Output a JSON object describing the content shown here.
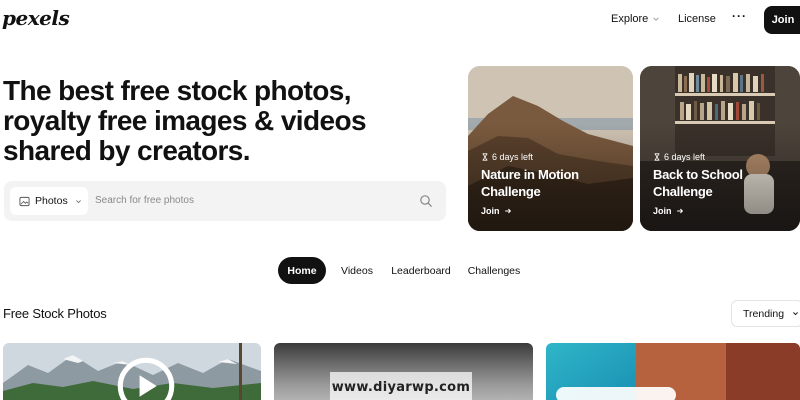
{
  "header": {
    "logo": "pexels",
    "nav": {
      "explore": "Explore",
      "license": "License",
      "more": "···",
      "join": "Join"
    }
  },
  "hero": {
    "title": "The best free stock photos, royalty free images & videos shared by creators.",
    "search": {
      "type_label": "Photos",
      "placeholder": "Search for free photos"
    }
  },
  "challenges": [
    {
      "time_left": "6 days left",
      "title": "Nature in Motion Challenge",
      "cta": "Join"
    },
    {
      "time_left": "6 days left",
      "title": "Back to School Challenge",
      "cta": "Join"
    }
  ],
  "tabs": [
    {
      "label": "Home",
      "active": true
    },
    {
      "label": "Videos"
    },
    {
      "label": "Leaderboard"
    },
    {
      "label": "Challenges"
    }
  ],
  "section": {
    "title": "Free Stock Photos",
    "sort": "Trending"
  },
  "watermark": "www.diyarwp.com",
  "colors": {
    "primary": "#111111",
    "search_bg": "#f3f3f3",
    "placeholder": "#8a8a8a"
  },
  "icons": [
    "image-icon",
    "chevron-down-icon",
    "search-icon",
    "hourglass-icon",
    "arrow-right-icon",
    "play-icon"
  ]
}
